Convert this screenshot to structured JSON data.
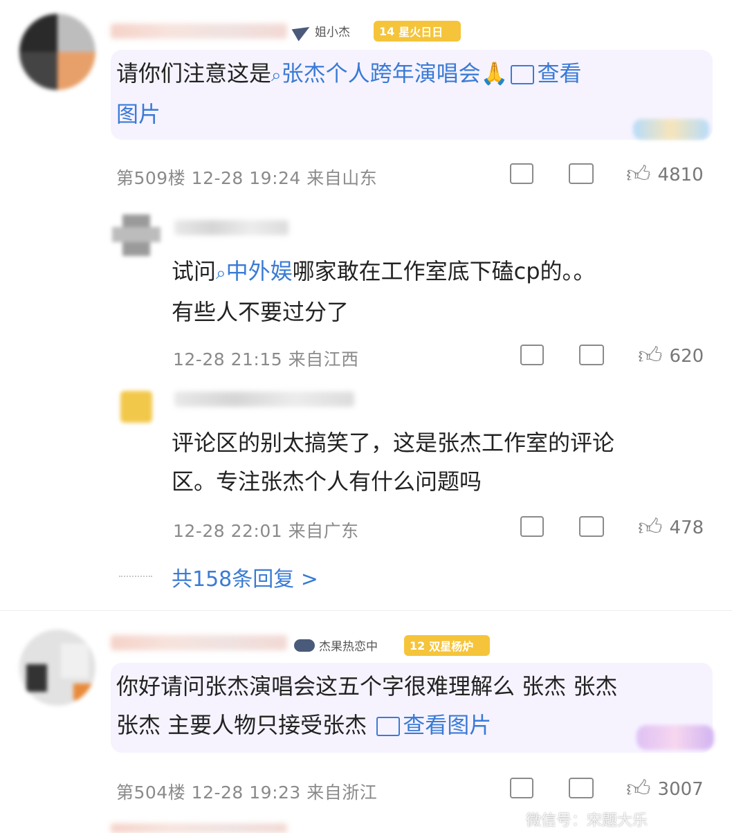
{
  "comments": [
    {
      "tag": "姐小杰",
      "level": "14",
      "badge": "星火日日",
      "text_pre": "请你们注意这是",
      "link_topic": "张杰个人跨年演唱会",
      "view_image": "查看",
      "view_image2": "图片",
      "meta": "第509楼  12-28  19:24  来自山东",
      "likes": "4810"
    },
    {
      "text_pre": "试问",
      "link_topic": "中外娱",
      "text_post": "哪家敢在工作室底下磕cp的。。",
      "text_line2": "有些人不要过分了",
      "meta": "12-28  21:15  来自江西",
      "likes": "620"
    },
    {
      "text_line1": "评论区的别太搞笑了，这是张杰工作室的评论",
      "text_line2": "区。专注张杰个人有什么问题吗",
      "meta": "12-28  22:01  来自广东",
      "likes": "478"
    },
    {
      "more_replies": "共158条回复 >"
    },
    {
      "tag": "杰果热恋中",
      "level": "12",
      "badge": "双星杨炉",
      "text_line1": "你好请问张杰演唱会这五个字很难理解么 张杰 张杰",
      "text_line2_pre": "张杰 主要人物只接受张杰",
      "view_image": "查看图片",
      "meta": "第504楼  12-28  19:23  来自浙江",
      "likes": "3007"
    }
  ],
  "watermark": "微信号：宋题大乐"
}
